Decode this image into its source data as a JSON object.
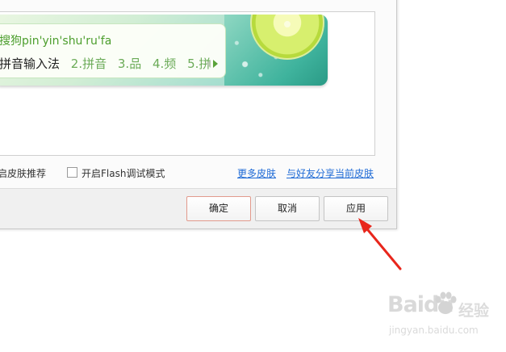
{
  "preview": {
    "pinyin": "搜狗pin'yin'shu'ru'fa",
    "candidates": [
      "拼音输入法",
      "2.拼音",
      "3.品",
      "4.频",
      "5.拼"
    ]
  },
  "options": {
    "skin_recommend_label": "启皮肤推荐",
    "flash_debug_label": "开启Flash调试模式",
    "more_skins_link": "更多皮肤",
    "share_skin_link": "与好友分享当前皮肤"
  },
  "buttons": {
    "ok": "确定",
    "cancel": "取消",
    "apply": "应用"
  },
  "watermark": {
    "brand": "Baidu",
    "jingyan": "经验",
    "url": "jingyan.baidu.com"
  },
  "colors": {
    "pinyin_green": "#4c9e2d",
    "link_blue": "#1f6bd6",
    "annotation_red": "#e8261c"
  }
}
